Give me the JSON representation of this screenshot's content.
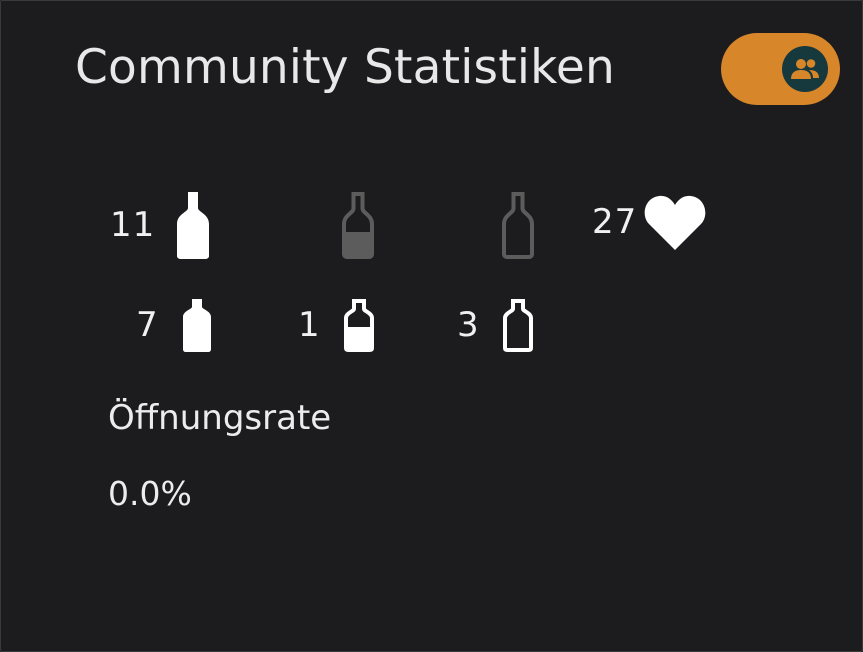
{
  "header": {
    "title": "Community Statistiken",
    "toggle_state": "on",
    "toggle_icon": "group-icon",
    "colors": {
      "toggle_bg": "#d7862a",
      "knob_bg": "#16393e",
      "knob_icon": "#d7862a"
    }
  },
  "stats": {
    "full_bottle": {
      "count": "11",
      "icon": "bottle-full-icon"
    },
    "half_bottle": {
      "count": "",
      "icon": "bottle-half-icon"
    },
    "empty_bottle": {
      "count": "",
      "icon": "bottle-empty-icon"
    },
    "likes": {
      "count": "27",
      "icon": "heart-icon"
    },
    "full_sample": {
      "count": "7",
      "icon": "sample-full-icon"
    },
    "half_sample": {
      "count": "1",
      "icon": "sample-half-icon"
    },
    "empty_sample": {
      "count": "3",
      "icon": "sample-empty-icon"
    }
  },
  "opening_rate": {
    "label": "Öffnungsrate",
    "value": "0.0%"
  }
}
